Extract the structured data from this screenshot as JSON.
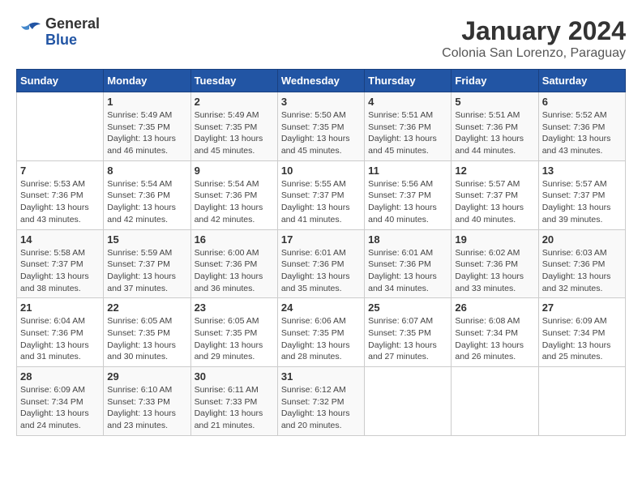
{
  "logo": {
    "general": "General",
    "blue": "Blue"
  },
  "title": "January 2024",
  "subtitle": "Colonia San Lorenzo, Paraguay",
  "days_of_week": [
    "Sunday",
    "Monday",
    "Tuesday",
    "Wednesday",
    "Thursday",
    "Friday",
    "Saturday"
  ],
  "weeks": [
    [
      {
        "day": "",
        "sunrise": "",
        "sunset": "",
        "daylight": ""
      },
      {
        "day": "1",
        "sunrise": "Sunrise: 5:49 AM",
        "sunset": "Sunset: 7:35 PM",
        "daylight": "Daylight: 13 hours and 46 minutes."
      },
      {
        "day": "2",
        "sunrise": "Sunrise: 5:49 AM",
        "sunset": "Sunset: 7:35 PM",
        "daylight": "Daylight: 13 hours and 45 minutes."
      },
      {
        "day": "3",
        "sunrise": "Sunrise: 5:50 AM",
        "sunset": "Sunset: 7:35 PM",
        "daylight": "Daylight: 13 hours and 45 minutes."
      },
      {
        "day": "4",
        "sunrise": "Sunrise: 5:51 AM",
        "sunset": "Sunset: 7:36 PM",
        "daylight": "Daylight: 13 hours and 45 minutes."
      },
      {
        "day": "5",
        "sunrise": "Sunrise: 5:51 AM",
        "sunset": "Sunset: 7:36 PM",
        "daylight": "Daylight: 13 hours and 44 minutes."
      },
      {
        "day": "6",
        "sunrise": "Sunrise: 5:52 AM",
        "sunset": "Sunset: 7:36 PM",
        "daylight": "Daylight: 13 hours and 43 minutes."
      }
    ],
    [
      {
        "day": "7",
        "sunrise": "Sunrise: 5:53 AM",
        "sunset": "Sunset: 7:36 PM",
        "daylight": "Daylight: 13 hours and 43 minutes."
      },
      {
        "day": "8",
        "sunrise": "Sunrise: 5:54 AM",
        "sunset": "Sunset: 7:36 PM",
        "daylight": "Daylight: 13 hours and 42 minutes."
      },
      {
        "day": "9",
        "sunrise": "Sunrise: 5:54 AM",
        "sunset": "Sunset: 7:36 PM",
        "daylight": "Daylight: 13 hours and 42 minutes."
      },
      {
        "day": "10",
        "sunrise": "Sunrise: 5:55 AM",
        "sunset": "Sunset: 7:37 PM",
        "daylight": "Daylight: 13 hours and 41 minutes."
      },
      {
        "day": "11",
        "sunrise": "Sunrise: 5:56 AM",
        "sunset": "Sunset: 7:37 PM",
        "daylight": "Daylight: 13 hours and 40 minutes."
      },
      {
        "day": "12",
        "sunrise": "Sunrise: 5:57 AM",
        "sunset": "Sunset: 7:37 PM",
        "daylight": "Daylight: 13 hours and 40 minutes."
      },
      {
        "day": "13",
        "sunrise": "Sunrise: 5:57 AM",
        "sunset": "Sunset: 7:37 PM",
        "daylight": "Daylight: 13 hours and 39 minutes."
      }
    ],
    [
      {
        "day": "14",
        "sunrise": "Sunrise: 5:58 AM",
        "sunset": "Sunset: 7:37 PM",
        "daylight": "Daylight: 13 hours and 38 minutes."
      },
      {
        "day": "15",
        "sunrise": "Sunrise: 5:59 AM",
        "sunset": "Sunset: 7:37 PM",
        "daylight": "Daylight: 13 hours and 37 minutes."
      },
      {
        "day": "16",
        "sunrise": "Sunrise: 6:00 AM",
        "sunset": "Sunset: 7:36 PM",
        "daylight": "Daylight: 13 hours and 36 minutes."
      },
      {
        "day": "17",
        "sunrise": "Sunrise: 6:01 AM",
        "sunset": "Sunset: 7:36 PM",
        "daylight": "Daylight: 13 hours and 35 minutes."
      },
      {
        "day": "18",
        "sunrise": "Sunrise: 6:01 AM",
        "sunset": "Sunset: 7:36 PM",
        "daylight": "Daylight: 13 hours and 34 minutes."
      },
      {
        "day": "19",
        "sunrise": "Sunrise: 6:02 AM",
        "sunset": "Sunset: 7:36 PM",
        "daylight": "Daylight: 13 hours and 33 minutes."
      },
      {
        "day": "20",
        "sunrise": "Sunrise: 6:03 AM",
        "sunset": "Sunset: 7:36 PM",
        "daylight": "Daylight: 13 hours and 32 minutes."
      }
    ],
    [
      {
        "day": "21",
        "sunrise": "Sunrise: 6:04 AM",
        "sunset": "Sunset: 7:36 PM",
        "daylight": "Daylight: 13 hours and 31 minutes."
      },
      {
        "day": "22",
        "sunrise": "Sunrise: 6:05 AM",
        "sunset": "Sunset: 7:35 PM",
        "daylight": "Daylight: 13 hours and 30 minutes."
      },
      {
        "day": "23",
        "sunrise": "Sunrise: 6:05 AM",
        "sunset": "Sunset: 7:35 PM",
        "daylight": "Daylight: 13 hours and 29 minutes."
      },
      {
        "day": "24",
        "sunrise": "Sunrise: 6:06 AM",
        "sunset": "Sunset: 7:35 PM",
        "daylight": "Daylight: 13 hours and 28 minutes."
      },
      {
        "day": "25",
        "sunrise": "Sunrise: 6:07 AM",
        "sunset": "Sunset: 7:35 PM",
        "daylight": "Daylight: 13 hours and 27 minutes."
      },
      {
        "day": "26",
        "sunrise": "Sunrise: 6:08 AM",
        "sunset": "Sunset: 7:34 PM",
        "daylight": "Daylight: 13 hours and 26 minutes."
      },
      {
        "day": "27",
        "sunrise": "Sunrise: 6:09 AM",
        "sunset": "Sunset: 7:34 PM",
        "daylight": "Daylight: 13 hours and 25 minutes."
      }
    ],
    [
      {
        "day": "28",
        "sunrise": "Sunrise: 6:09 AM",
        "sunset": "Sunset: 7:34 PM",
        "daylight": "Daylight: 13 hours and 24 minutes."
      },
      {
        "day": "29",
        "sunrise": "Sunrise: 6:10 AM",
        "sunset": "Sunset: 7:33 PM",
        "daylight": "Daylight: 13 hours and 23 minutes."
      },
      {
        "day": "30",
        "sunrise": "Sunrise: 6:11 AM",
        "sunset": "Sunset: 7:33 PM",
        "daylight": "Daylight: 13 hours and 21 minutes."
      },
      {
        "day": "31",
        "sunrise": "Sunrise: 6:12 AM",
        "sunset": "Sunset: 7:32 PM",
        "daylight": "Daylight: 13 hours and 20 minutes."
      },
      {
        "day": "",
        "sunrise": "",
        "sunset": "",
        "daylight": ""
      },
      {
        "day": "",
        "sunrise": "",
        "sunset": "",
        "daylight": ""
      },
      {
        "day": "",
        "sunrise": "",
        "sunset": "",
        "daylight": ""
      }
    ]
  ]
}
